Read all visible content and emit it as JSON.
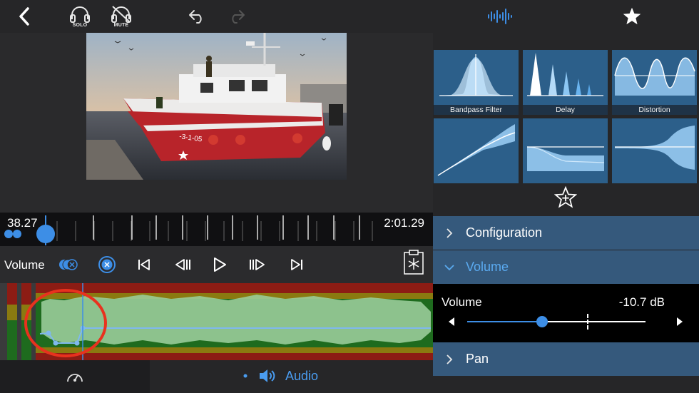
{
  "toolbar": {
    "back_icon": "chevron-left-icon",
    "solo_label": "SOLO",
    "mute_label": "MUTE",
    "undo_icon": "undo-icon",
    "redo_icon": "redo-icon",
    "waveform_icon": "waveform-icon",
    "favorite_icon": "star-icon"
  },
  "effects": [
    {
      "label": "Bandpass Filter",
      "icon": "bandpass-filter-icon"
    },
    {
      "label": "Delay",
      "icon": "delay-icon"
    },
    {
      "label": "Distortion",
      "icon": "distortion-icon"
    },
    {
      "label": "",
      "icon": "compressor-icon"
    },
    {
      "label": "",
      "icon": "expander-icon"
    },
    {
      "label": "",
      "icon": "spread-icon"
    }
  ],
  "favorites_icon": "star-plus-icon",
  "inspector": {
    "sections": [
      {
        "label": "Configuration",
        "open": false
      },
      {
        "label": "Volume",
        "open": true
      },
      {
        "label": "Pan",
        "open": false
      }
    ],
    "volume": {
      "label": "Volume",
      "value": "-10.7 dB",
      "slider_fraction": 0.42
    }
  },
  "timeline": {
    "current_time": "38.27",
    "end_time": "2:01.29"
  },
  "controls": {
    "label": "Volume",
    "buttons": [
      "keyframe-toggle-icon",
      "remove-keyframe-icon",
      "skip-start-icon",
      "prev-keyframe-icon",
      "play-icon",
      "next-keyframe-icon",
      "skip-end-icon",
      "clipboard-icon"
    ]
  },
  "bottom": {
    "speed_icon": "speedometer-icon",
    "audio_label": "Audio",
    "audio_icon": "speaker-icon"
  },
  "colors": {
    "accent": "#4a9cf0",
    "tile": "#2c5f8a",
    "section": "#35597c",
    "annotation": "#e8321e"
  }
}
